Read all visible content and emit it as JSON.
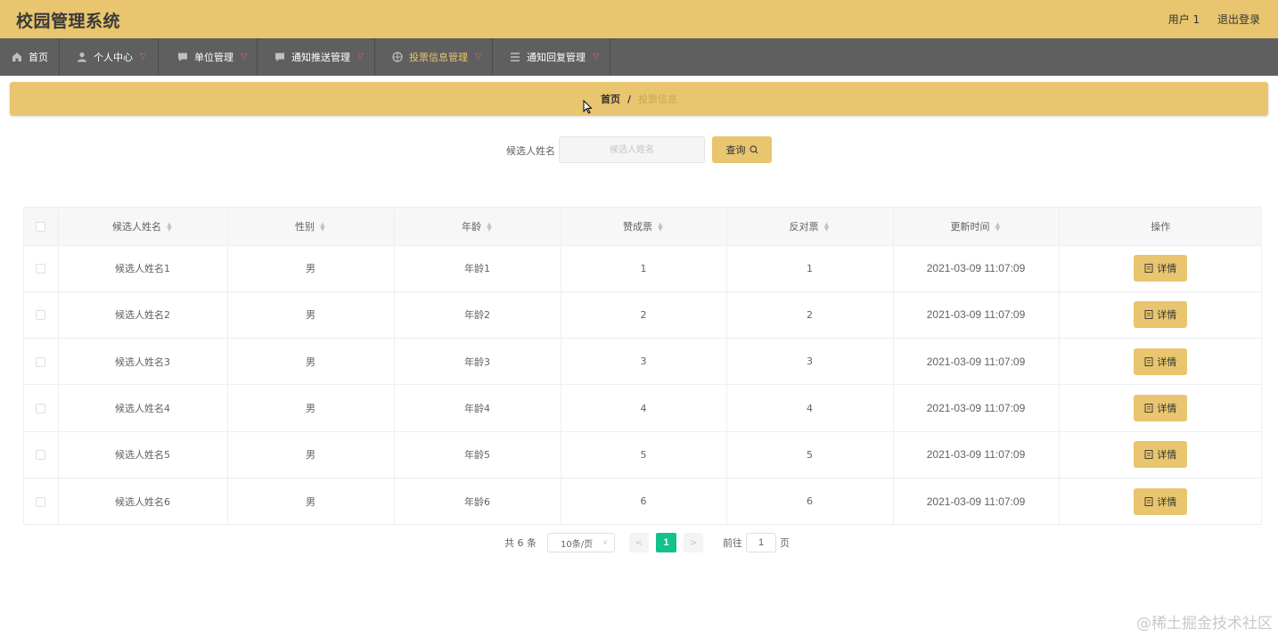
{
  "header": {
    "app_title": "校园管理系统",
    "user_label": "用户 1",
    "logout_label": "退出登录"
  },
  "nav": {
    "items": [
      {
        "label": "首页",
        "icon": "home-icon",
        "has_caret": false,
        "active": false
      },
      {
        "label": "个人中心",
        "icon": "user-icon",
        "has_caret": true,
        "active": false
      },
      {
        "label": "单位管理",
        "icon": "message-icon",
        "has_caret": true,
        "active": false
      },
      {
        "label": "通知推送管理",
        "icon": "message-icon",
        "has_caret": true,
        "active": false
      },
      {
        "label": "投票信息管理",
        "icon": "basketball-icon",
        "has_caret": true,
        "active": true
      },
      {
        "label": "通知回复管理",
        "icon": "list-icon",
        "has_caret": true,
        "active": false
      }
    ]
  },
  "breadcrumb": {
    "home": "首页",
    "separator": "/",
    "current": "投票信息"
  },
  "search": {
    "label": "候选人姓名",
    "placeholder": "候选人姓名",
    "button_label": "查询"
  },
  "table": {
    "columns": [
      "候选人姓名",
      "性别",
      "年龄",
      "赞成票",
      "反对票",
      "更新时间",
      "操作"
    ],
    "rows": [
      {
        "name": "候选人姓名1",
        "gender": "男",
        "age": "年龄1",
        "yes": "1",
        "no": "1",
        "updated": "2021-03-09 11:07:09"
      },
      {
        "name": "候选人姓名2",
        "gender": "男",
        "age": "年龄2",
        "yes": "2",
        "no": "2",
        "updated": "2021-03-09 11:07:09"
      },
      {
        "name": "候选人姓名3",
        "gender": "男",
        "age": "年龄3",
        "yes": "3",
        "no": "3",
        "updated": "2021-03-09 11:07:09"
      },
      {
        "name": "候选人姓名4",
        "gender": "男",
        "age": "年龄4",
        "yes": "4",
        "no": "4",
        "updated": "2021-03-09 11:07:09"
      },
      {
        "name": "候选人姓名5",
        "gender": "男",
        "age": "年龄5",
        "yes": "5",
        "no": "5",
        "updated": "2021-03-09 11:07:09"
      },
      {
        "name": "候选人姓名6",
        "gender": "男",
        "age": "年龄6",
        "yes": "6",
        "no": "6",
        "updated": "2021-03-09 11:07:09"
      }
    ],
    "detail_label": "详情"
  },
  "pagination": {
    "total": "共 6 条",
    "page_size": "10条/页",
    "current_page": "1",
    "goto_label": "前往",
    "goto_value": "1",
    "page_suffix": "页"
  },
  "watermark": "@稀土掘金技术社区",
  "colors": {
    "header_bg": "#e8c56e",
    "nav_bg": "#5f5f5f",
    "pager_active": "#13c18a"
  }
}
